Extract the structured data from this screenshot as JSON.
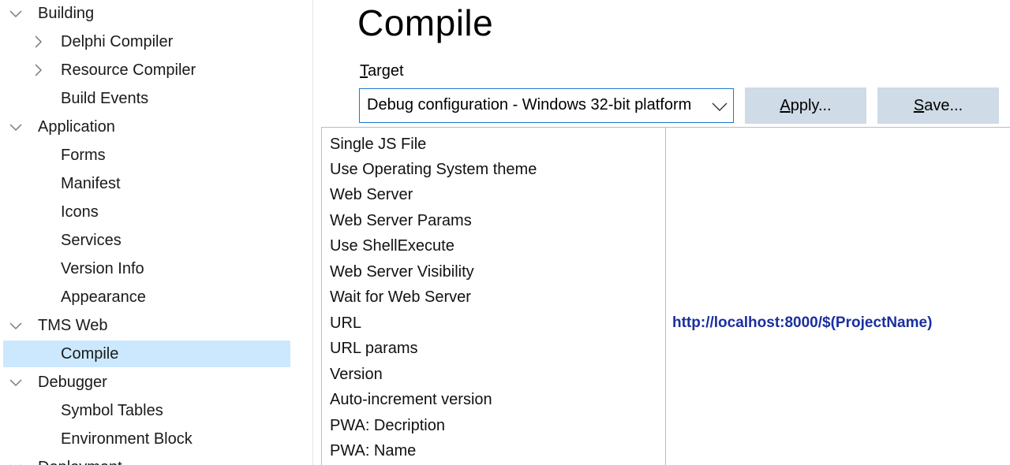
{
  "tree": {
    "items": [
      {
        "label": "Building",
        "expander": "chevron-down"
      },
      {
        "label": "Delphi Compiler",
        "expander": "chevron-right"
      },
      {
        "label": "Resource Compiler",
        "expander": "chevron-right"
      },
      {
        "label": "Build Events",
        "expander": ""
      },
      {
        "label": "Application",
        "expander": "chevron-down"
      },
      {
        "label": "Forms",
        "expander": ""
      },
      {
        "label": "Manifest",
        "expander": ""
      },
      {
        "label": "Icons",
        "expander": ""
      },
      {
        "label": "Services",
        "expander": ""
      },
      {
        "label": "Version Info",
        "expander": ""
      },
      {
        "label": "Appearance",
        "expander": ""
      },
      {
        "label": "TMS Web",
        "expander": "chevron-down"
      },
      {
        "label": "Compile",
        "expander": "",
        "selected": true
      },
      {
        "label": "Debugger",
        "expander": "chevron-down"
      },
      {
        "label": "Symbol Tables",
        "expander": ""
      },
      {
        "label": "Environment Block",
        "expander": ""
      },
      {
        "label": "Deployment",
        "expander": "chevron-down"
      }
    ]
  },
  "main": {
    "title": "Compile",
    "target_label_first": "T",
    "target_label_rest": "arget",
    "target_value": "Debug configuration - Windows 32-bit platform",
    "apply_first": "A",
    "apply_rest": "pply...",
    "save_first": "S",
    "save_rest": "ave..."
  },
  "grid": {
    "rows": [
      {
        "name": "Single JS File",
        "value": ""
      },
      {
        "name": "Use Operating System theme",
        "value": ""
      },
      {
        "name": "Web Server",
        "value": ""
      },
      {
        "name": "Web Server Params",
        "value": ""
      },
      {
        "name": "Use ShellExecute",
        "value": ""
      },
      {
        "name": "Web Server Visibility",
        "value": ""
      },
      {
        "name": "Wait for Web Server",
        "value": ""
      },
      {
        "name": "URL",
        "value": "http://localhost:8000/$(ProjectName)"
      },
      {
        "name": "URL params",
        "value": ""
      },
      {
        "name": "Version",
        "value": ""
      },
      {
        "name": "Auto-increment version",
        "value": ""
      },
      {
        "name": "PWA: Decription",
        "value": ""
      },
      {
        "name": "PWA: Name",
        "value": ""
      }
    ]
  },
  "colors": {
    "selection": "#cce8ff",
    "accent_border": "#1c78d4",
    "button_bg": "#cfdbe6",
    "value_text": "#1a2fa0"
  }
}
